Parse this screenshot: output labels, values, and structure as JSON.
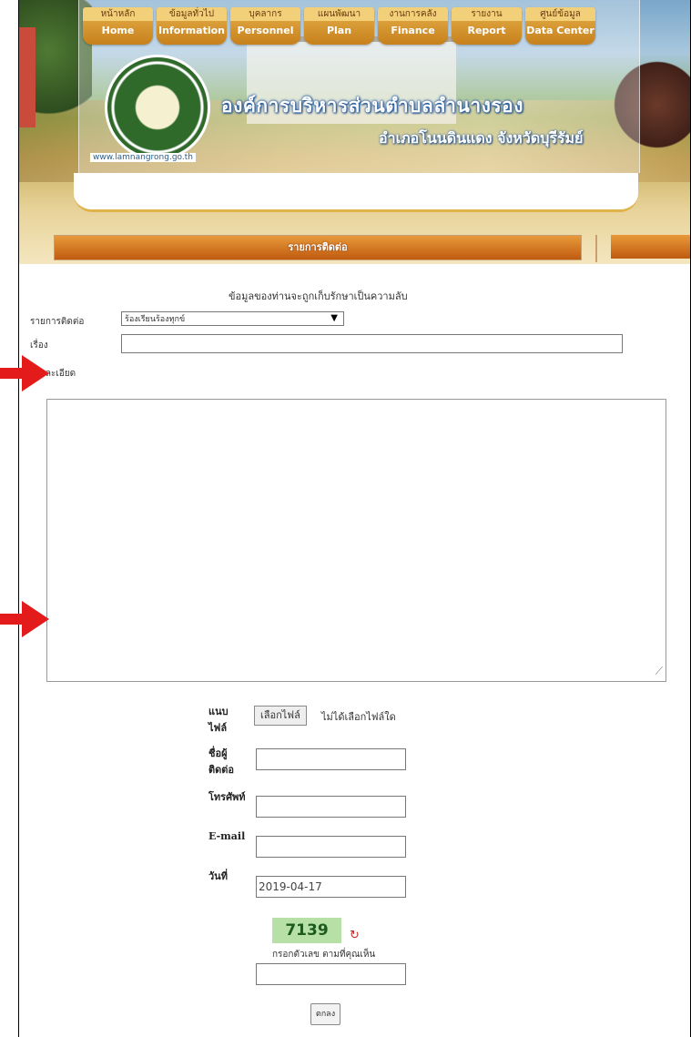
{
  "nav": [
    {
      "th": "หน้าหลัก",
      "en": "Home"
    },
    {
      "th": "ข้อมูลทั่วไป",
      "en": "Information"
    },
    {
      "th": "บุคลากร",
      "en": "Personnel"
    },
    {
      "th": "แผนพัฒนา",
      "en": "Plan"
    },
    {
      "th": "งานการคลัง",
      "en": "Finance"
    },
    {
      "th": "รายงาน",
      "en": "Report"
    },
    {
      "th": "ศูนย์ข้อมูล",
      "en": "Data Center"
    }
  ],
  "header": {
    "org_title": "องค์การบริหารส่วนตำบลลำนางรอง",
    "org_subtitle": "อำเภอโนนดินแดง จังหวัดบุรีรัมย์",
    "seal_url": "www.lamnangrong.go.th"
  },
  "section": {
    "title": "รายการติดต่อ"
  },
  "form": {
    "notice": "ข้อมูลของท่านจะถูกเก็บรักษาเป็นความลับ",
    "contact_type_label": "รายการติดต่อ",
    "contact_type_value": "ร้องเรียนร้องทุกข์",
    "subject_label": "เรื่อง",
    "detail_label": "รายละเอียด",
    "attach_label": "แนบไฟล์",
    "file_button": "เลือกไฟล์",
    "file_status": "ไม่ได้เลือกไฟล์ใด",
    "name_label": "ชื่อผู้ติดต่อ",
    "phone_label": "โทรศัพท์",
    "email_label": "E-mail",
    "date_label": "วันที่",
    "date_value": "2019-04-17",
    "captcha_code": "7139",
    "captcha_hint": "กรอกตัวเลข ตามที่คุณเห็น",
    "submit_label": "ตกลง"
  },
  "colors": {
    "arrow": "#e31b1b",
    "nav_bg": "#c6801c",
    "section_bar": "#c05a10"
  }
}
